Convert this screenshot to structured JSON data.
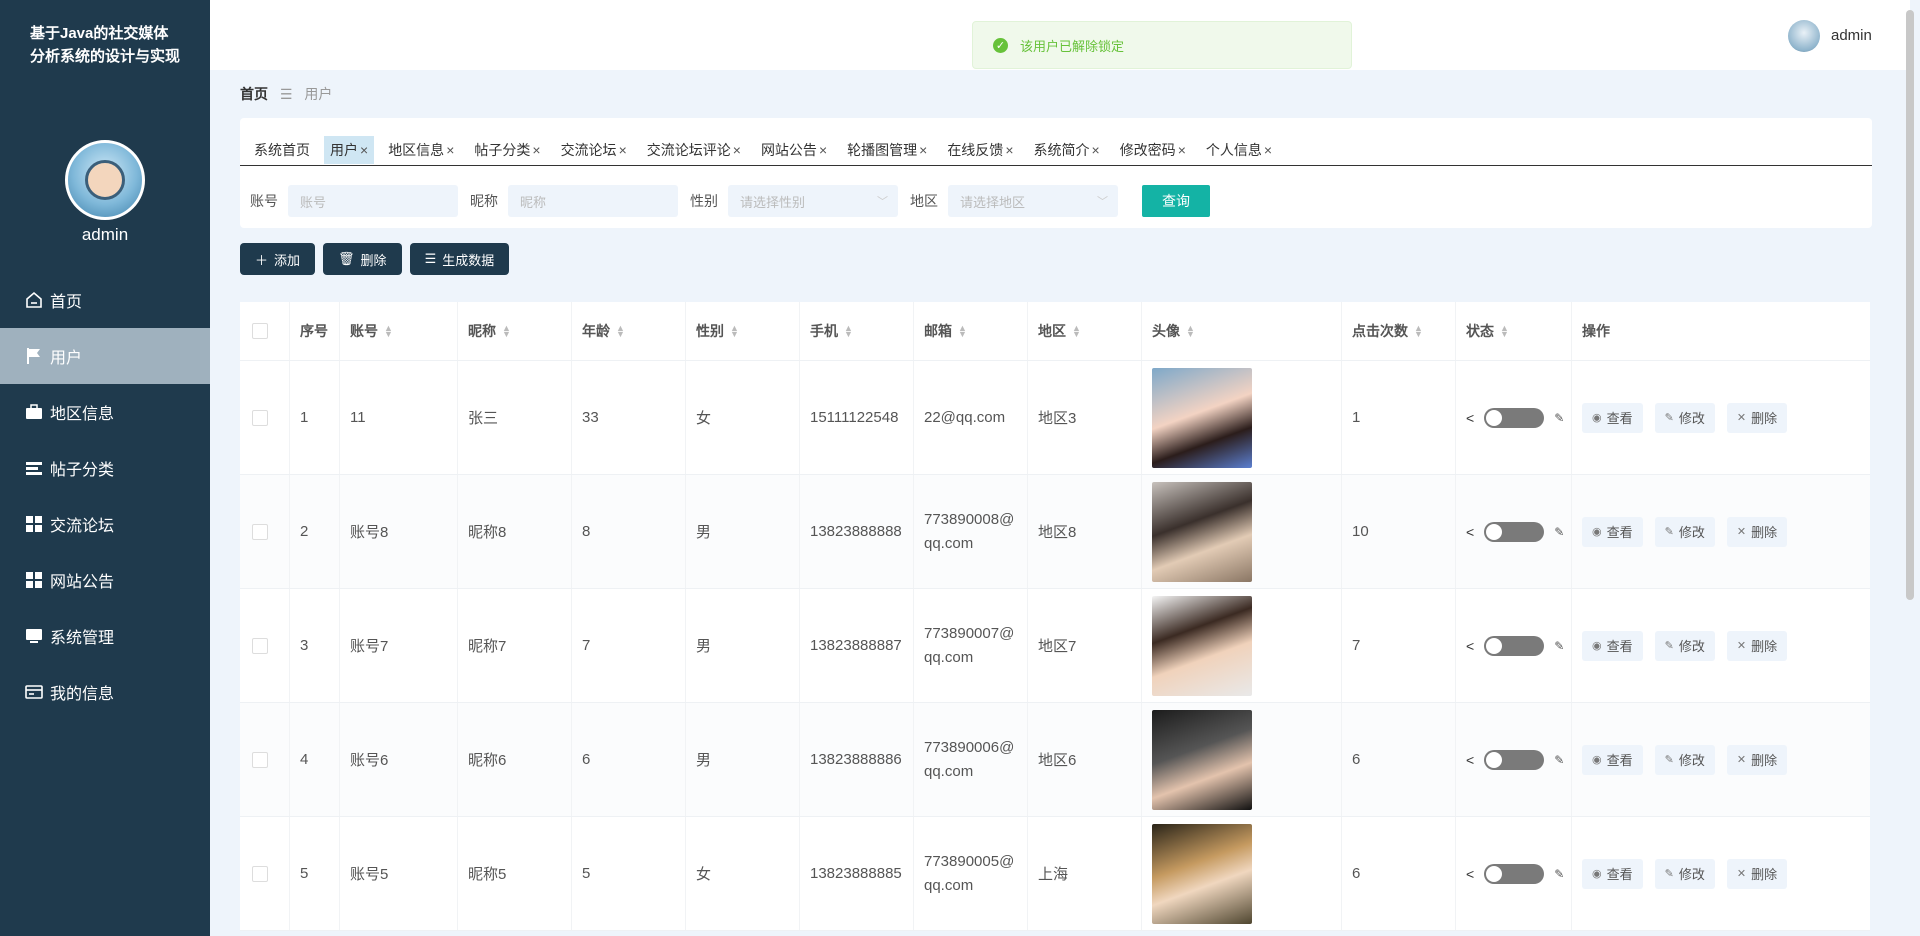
{
  "sidebar": {
    "app_title": "基于Java的社交媒体分析系统的设计与实现",
    "user": "admin",
    "items": [
      {
        "label": "首页",
        "icon": "home-icon"
      },
      {
        "label": "用户",
        "icon": "flag-icon"
      },
      {
        "label": "地区信息",
        "icon": "briefcase-icon"
      },
      {
        "label": "帖子分类",
        "icon": "list-icon"
      },
      {
        "label": "交流论坛",
        "icon": "grid-icon"
      },
      {
        "label": "网站公告",
        "icon": "grid-icon"
      },
      {
        "label": "系统管理",
        "icon": "monitor-icon"
      },
      {
        "label": "我的信息",
        "icon": "card-icon"
      }
    ]
  },
  "header": {
    "toast": "该用户已解除锁定",
    "username": "admin"
  },
  "breadcrumb": {
    "home": "首页",
    "separator": "☰",
    "current": "用户"
  },
  "tabs": [
    "系统首页",
    "用户",
    "地区信息",
    "帖子分类",
    "交流论坛",
    "交流论坛评论",
    "网站公告",
    "轮播图管理",
    "在线反馈",
    "系统简介",
    "修改密码",
    "个人信息"
  ],
  "filters": {
    "account_label": "账号",
    "account_placeholder": "账号",
    "nickname_label": "昵称",
    "nickname_placeholder": "昵称",
    "gender_label": "性别",
    "gender_placeholder": "请选择性别",
    "region_label": "地区",
    "region_placeholder": "请选择地区",
    "query_label": "查询"
  },
  "actions": {
    "add": "添加",
    "delete": "删除",
    "generate": "生成数据"
  },
  "table": {
    "headers": {
      "index": "序号",
      "account": "账号",
      "nickname": "昵称",
      "age": "年龄",
      "gender": "性别",
      "phone": "手机",
      "email": "邮箱",
      "region": "地区",
      "avatar": "头像",
      "clicks": "点击次数",
      "status": "状态",
      "ops": "操作"
    },
    "ops": {
      "view": "查看",
      "edit": "修改",
      "delete": "删除"
    },
    "rows": [
      {
        "index": "1",
        "account": "11",
        "nickname": "张三",
        "age": "33",
        "gender": "女",
        "phone": "15111122548",
        "email": "22@qq.com",
        "region": "地区3",
        "clicks": "1"
      },
      {
        "index": "2",
        "account": "账号8",
        "nickname": "昵称8",
        "age": "8",
        "gender": "男",
        "phone": "13823888888",
        "email": "773890008@qq.com",
        "region": "地区8",
        "clicks": "10"
      },
      {
        "index": "3",
        "account": "账号7",
        "nickname": "昵称7",
        "age": "7",
        "gender": "男",
        "phone": "13823888887",
        "email": "773890007@qq.com",
        "region": "地区7",
        "clicks": "7"
      },
      {
        "index": "4",
        "account": "账号6",
        "nickname": "昵称6",
        "age": "6",
        "gender": "男",
        "phone": "13823888886",
        "email": "773890006@qq.com",
        "region": "地区6",
        "clicks": "6"
      },
      {
        "index": "5",
        "account": "账号5",
        "nickname": "昵称5",
        "age": "5",
        "gender": "女",
        "phone": "13823888885",
        "email": "773890005@qq.com",
        "region": "上海",
        "clicks": "6"
      }
    ]
  },
  "colors": {
    "sidebar_bg": "#1f3a4d",
    "active_item": "#9fb1be",
    "query_btn": "#14b3a5",
    "toast_text": "#67c23a"
  }
}
